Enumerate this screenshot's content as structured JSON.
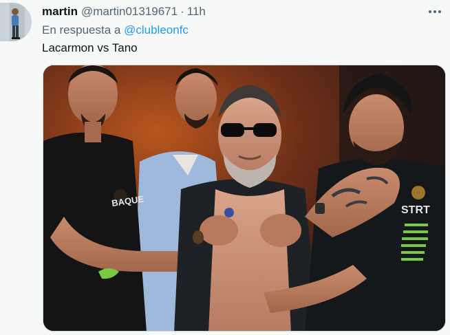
{
  "tweet": {
    "display_name": "martin",
    "handle": "@martin01319671",
    "separator": "·",
    "time": "11h",
    "reply_prefix": "En respuesta a",
    "reply_to": "@clubleonfc",
    "text": "Lacarmon vs Tano"
  },
  "icons": {
    "more": "more-horizontal-icon"
  },
  "colors": {
    "accent": "#1d9bf0",
    "secondary_text": "#536471",
    "primary_text": "#0f1419",
    "background": "#f7f9f9"
  }
}
